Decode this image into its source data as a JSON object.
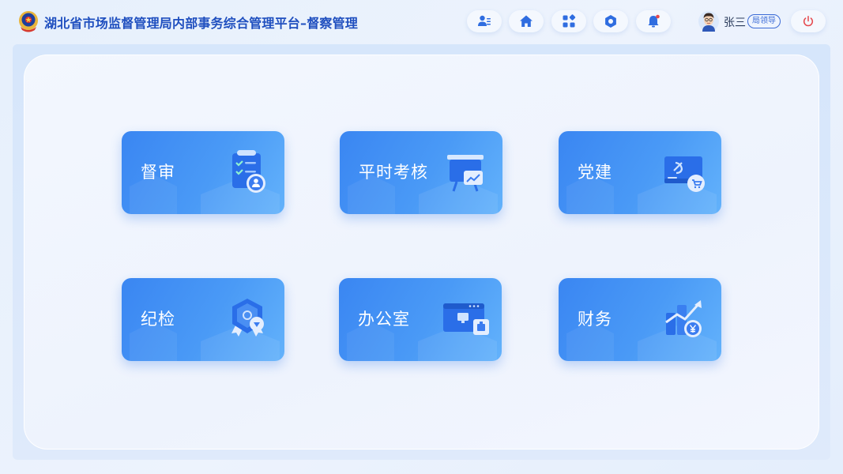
{
  "header": {
    "title": "湖北省市场监督管理局内部事务综合管理平台–督察管理",
    "logo_icon": "police-emblem-icon",
    "nav": [
      {
        "icon": "user-list-icon"
      },
      {
        "icon": "home-icon"
      },
      {
        "icon": "apps-grid-icon"
      },
      {
        "icon": "settings-icon"
      },
      {
        "icon": "bell-icon"
      }
    ],
    "user": {
      "name": "张三",
      "role": "局领导",
      "avatar_icon": "avatar-icon"
    },
    "power_icon": "power-icon"
  },
  "modules": [
    {
      "label": "督审",
      "icon": "audit-clipboard-icon"
    },
    {
      "label": "平时考核",
      "icon": "presentation-board-icon"
    },
    {
      "label": "党建",
      "icon": "party-flag-icon"
    },
    {
      "label": "纪检",
      "icon": "shield-badge-icon"
    },
    {
      "label": "办公室",
      "icon": "office-window-icon"
    },
    {
      "label": "财务",
      "icon": "finance-chart-icon"
    }
  ],
  "colors": {
    "title": "#1f4fbf",
    "card_start": "#3a86f2",
    "card_end": "#63b2fb",
    "accent": "#2f6de0",
    "power": "#e5484d"
  }
}
